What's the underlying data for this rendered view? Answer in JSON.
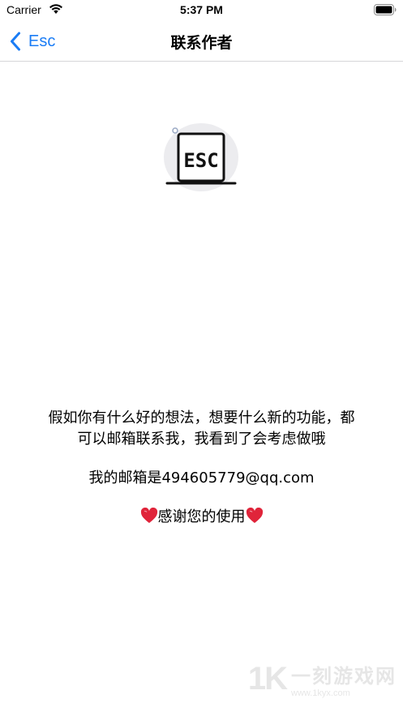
{
  "status_bar": {
    "carrier": "Carrier",
    "time": "5:37 PM",
    "wifi_icon": "wifi-icon",
    "battery_icon": "battery-full-icon"
  },
  "nav": {
    "back_label": "Esc",
    "back_icon": "chevron-left-icon",
    "title": "联系作者",
    "accent_color": "#1a7cf5"
  },
  "logo": {
    "text": "ESC",
    "icon": "laptop-esc-icon"
  },
  "content": {
    "line1": "假如你有什么好的想法，想要什么新的功能，都",
    "line2": "可以邮箱联系我，我看到了会考虑做哦",
    "email_line": "我的邮箱是494605779@qq.com",
    "thanks": "感谢您的使用",
    "heart_icon": "red-heart-icon",
    "heart_color": "#e0243a"
  },
  "watermark": {
    "logo": "1K",
    "name": "一刻游戏网",
    "url": "www.1kyx.com"
  }
}
